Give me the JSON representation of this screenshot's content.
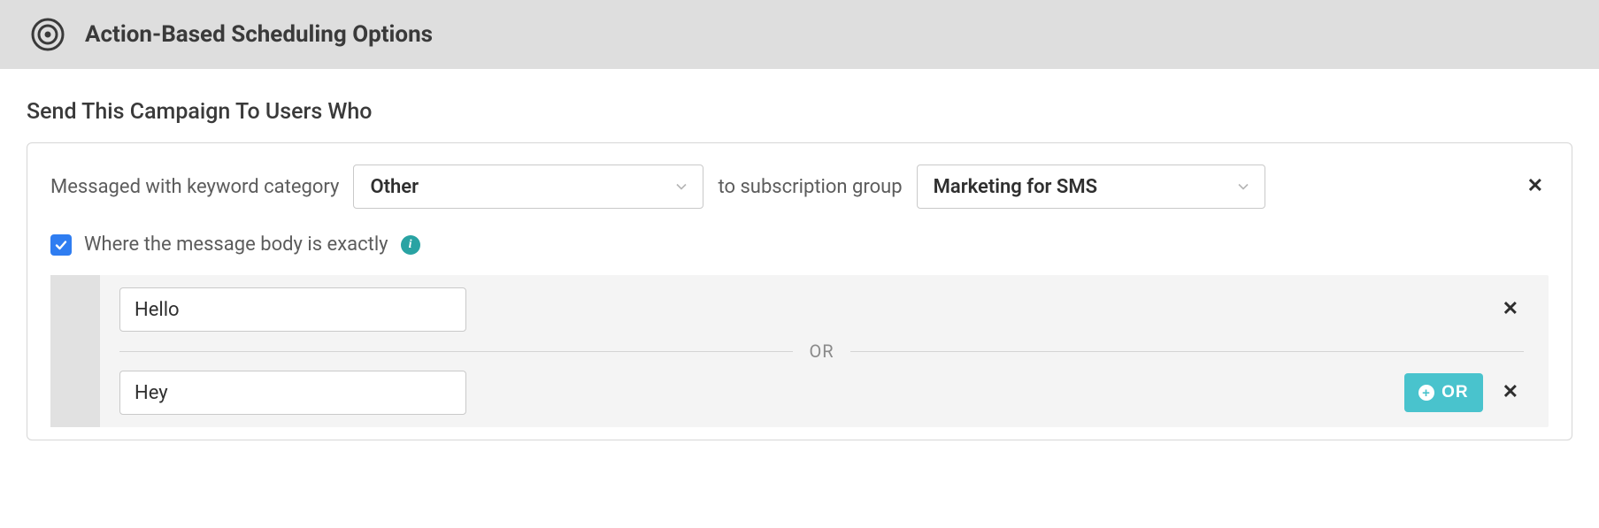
{
  "header": {
    "title": "Action-Based Scheduling Options"
  },
  "section": {
    "heading": "Send This Campaign To Users Who",
    "trigger": {
      "prefix_label": "Messaged with keyword category",
      "category_value": "Other",
      "mid_label": "to subscription group",
      "group_value": "Marketing for SMS"
    },
    "body_filter": {
      "checked": true,
      "label": "Where the message body is exactly",
      "conditions": [
        {
          "value": "Hello"
        },
        {
          "value": "Hey"
        }
      ],
      "separator_label": "OR",
      "add_button_label": "OR"
    }
  }
}
